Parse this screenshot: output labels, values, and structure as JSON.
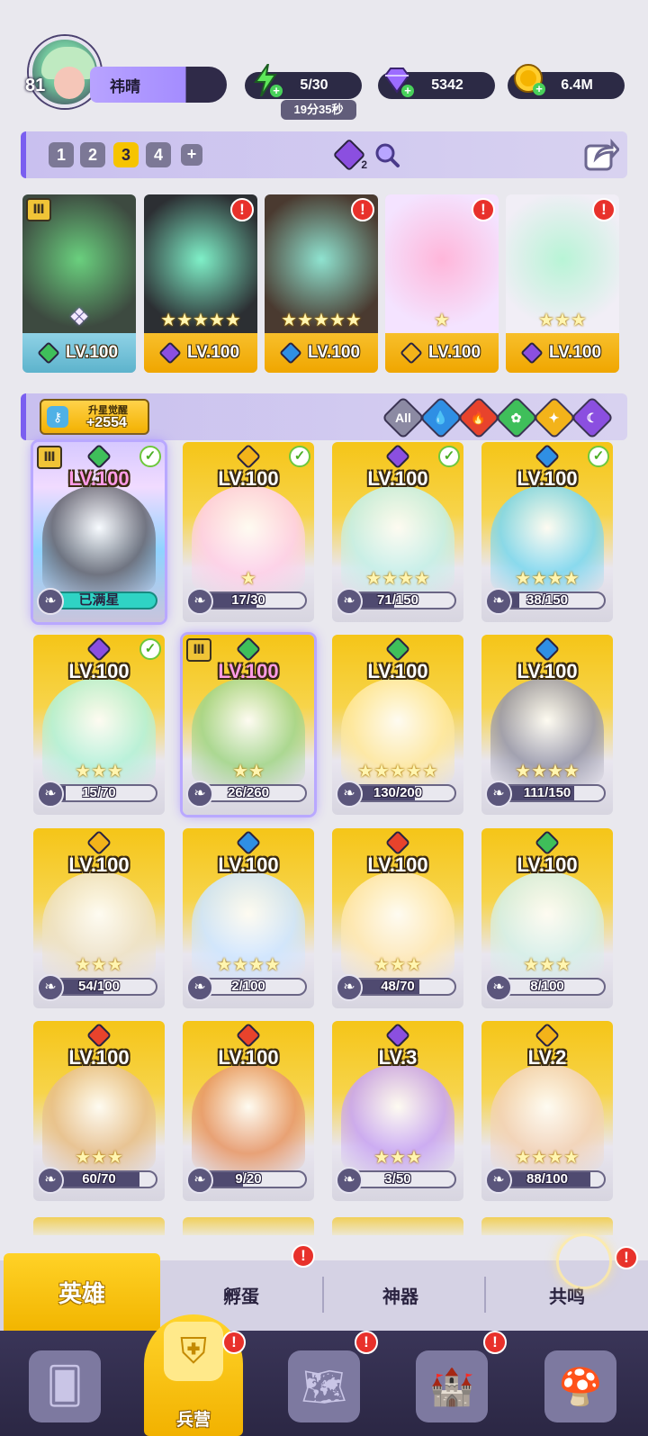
{
  "player": {
    "level": "81",
    "name": "祎晴"
  },
  "resources": {
    "energy": "5/30",
    "energy_timer": "19分35秒",
    "gems": "5342",
    "coins": "6.4M"
  },
  "teams": {
    "tabs": [
      "1",
      "2",
      "3",
      "4"
    ],
    "active": "3",
    "add": "+",
    "badge_count": "2"
  },
  "lineup": [
    {
      "level": "LV.100",
      "element": "green",
      "stars": 0
    },
    {
      "level": "LV.100",
      "element": "purple",
      "stars": 5
    },
    {
      "level": "LV.100",
      "element": "blue",
      "stars": 5
    },
    {
      "level": "LV.100",
      "element": "gold",
      "stars": 1
    },
    {
      "level": "LV.100",
      "element": "purple",
      "stars": 3
    }
  ],
  "awaken": {
    "title": "升星觉醒",
    "value": "+2554"
  },
  "filters": [
    "All",
    "water",
    "fire",
    "nature",
    "light",
    "dark"
  ],
  "heroes": [
    {
      "level": "LV.100",
      "element": "green",
      "progress": "已满星",
      "fill": 1.0,
      "check": true
    },
    {
      "level": "LV.100",
      "element": "gold",
      "progress": "17/30",
      "fill": 0.57,
      "check": true
    },
    {
      "level": "LV.100",
      "element": "purple",
      "progress": "71/150",
      "fill": 0.47,
      "check": true
    },
    {
      "level": "LV.100",
      "element": "blue",
      "progress": "38/150",
      "fill": 0.25,
      "check": true
    },
    {
      "level": "LV.100",
      "element": "purple",
      "progress": "15/70",
      "fill": 0.21,
      "check": true
    },
    {
      "level": "LV.100",
      "element": "green",
      "progress": "26/260",
      "fill": 0.1,
      "check": false
    },
    {
      "level": "LV.100",
      "element": "green",
      "progress": "130/200",
      "fill": 0.65,
      "check": false
    },
    {
      "level": "LV.100",
      "element": "blue",
      "progress": "111/150",
      "fill": 0.74,
      "check": false
    },
    {
      "level": "LV.100",
      "element": "gold",
      "progress": "54/100",
      "fill": 0.54,
      "check": false
    },
    {
      "level": "LV.100",
      "element": "blue",
      "progress": "2/100",
      "fill": 0.02,
      "check": false
    },
    {
      "level": "LV.100",
      "element": "red",
      "progress": "48/70",
      "fill": 0.69,
      "check": false
    },
    {
      "level": "LV.100",
      "element": "green",
      "progress": "8/100",
      "fill": 0.08,
      "check": false
    },
    {
      "level": "LV.100",
      "element": "red",
      "progress": "60/70",
      "fill": 0.86,
      "check": false
    },
    {
      "level": "LV.100",
      "element": "red",
      "progress": "9/20",
      "fill": 0.45,
      "check": false
    },
    {
      "level": "LV.3",
      "element": "purple",
      "progress": "3/50",
      "fill": 0.06,
      "check": false
    },
    {
      "level": "LV.2",
      "element": "gold",
      "progress": "88/100",
      "fill": 0.88,
      "check": false
    }
  ],
  "bottom_tabs": {
    "hero": "英雄",
    "hatch": "孵蛋",
    "artifact": "神器",
    "resonance": "共鸣"
  },
  "nav": {
    "barracks": "兵营"
  },
  "colors": {
    "green": "#3fbf5a",
    "purple": "#8b4fe0",
    "blue": "#2f8fe4",
    "gold": "#f3b31a",
    "red": "#e8432c",
    "accent": "#7a5ff0",
    "yellow": "#f5c518"
  }
}
